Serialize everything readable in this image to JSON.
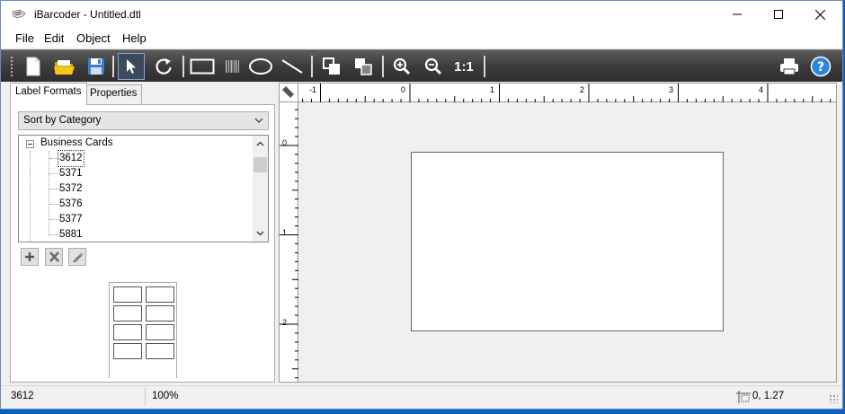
{
  "window": {
    "title": "iBarcoder - Untitled.dtl",
    "min_icon": "minimize-icon",
    "max_icon": "maximize-icon",
    "close_icon": "close-icon"
  },
  "menu": [
    "File",
    "Edit",
    "Object",
    "Help"
  ],
  "toolbar": {
    "actual_size_label": "1:1",
    "active_tool": "select-pointer"
  },
  "left_panel": {
    "tabs": [
      {
        "label": "Label Formats",
        "selected": true
      },
      {
        "label": "Properties",
        "selected": false
      }
    ],
    "sort_combo_value": "Sort by Category",
    "tree": {
      "root": "Business Cards",
      "items": [
        "3612",
        "5371",
        "5372",
        "5376",
        "5377",
        "5881"
      ],
      "selected": "3612"
    }
  },
  "ruler": {
    "h_labels": [
      "-1",
      "0",
      "1",
      "2",
      "3",
      "4"
    ],
    "v_labels": [
      "0",
      "1",
      "2"
    ]
  },
  "status": {
    "format": "3612",
    "zoom": "100%",
    "coords": "0, 1.27"
  },
  "colors": {
    "toolbar_bg": "#3c3c3c",
    "accent_blue": "#0a63b8",
    "folder_yellow": "#f5c518"
  }
}
